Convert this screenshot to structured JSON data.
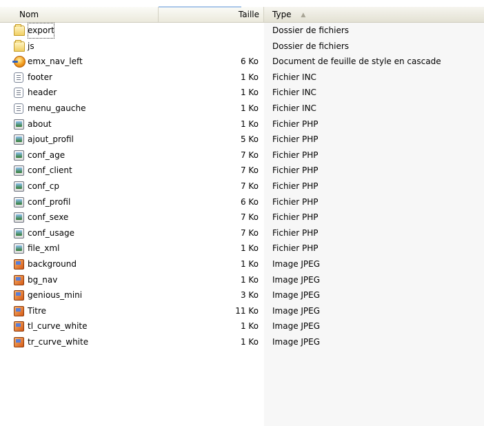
{
  "columns": {
    "name": "Nom",
    "size": "Taille",
    "type": "Type"
  },
  "sort_column": "type",
  "files": [
    {
      "name": "export",
      "size": "",
      "type": "Dossier de fichiers",
      "icon": "folder-icon",
      "focused": true
    },
    {
      "name": "js",
      "size": "",
      "type": "Dossier de fichiers",
      "icon": "folder-icon"
    },
    {
      "name": "emx_nav_left",
      "size": "6 Ko",
      "type": "Document de feuille de style en cascade",
      "icon": "css-file-icon"
    },
    {
      "name": "footer",
      "size": "1 Ko",
      "type": "Fichier INC",
      "icon": "text-file-icon"
    },
    {
      "name": "header",
      "size": "1 Ko",
      "type": "Fichier INC",
      "icon": "text-file-icon"
    },
    {
      "name": "menu_gauche",
      "size": "1 Ko",
      "type": "Fichier INC",
      "icon": "text-file-icon"
    },
    {
      "name": "about",
      "size": "1 Ko",
      "type": "Fichier PHP",
      "icon": "php-file-icon"
    },
    {
      "name": "ajout_profil",
      "size": "5 Ko",
      "type": "Fichier PHP",
      "icon": "php-file-icon"
    },
    {
      "name": "conf_age",
      "size": "7 Ko",
      "type": "Fichier PHP",
      "icon": "php-file-icon"
    },
    {
      "name": "conf_client",
      "size": "7 Ko",
      "type": "Fichier PHP",
      "icon": "php-file-icon"
    },
    {
      "name": "conf_cp",
      "size": "7 Ko",
      "type": "Fichier PHP",
      "icon": "php-file-icon"
    },
    {
      "name": "conf_profil",
      "size": "6 Ko",
      "type": "Fichier PHP",
      "icon": "php-file-icon"
    },
    {
      "name": "conf_sexe",
      "size": "7 Ko",
      "type": "Fichier PHP",
      "icon": "php-file-icon"
    },
    {
      "name": "conf_usage",
      "size": "7 Ko",
      "type": "Fichier PHP",
      "icon": "php-file-icon"
    },
    {
      "name": "file_xml",
      "size": "1 Ko",
      "type": "Fichier PHP",
      "icon": "php-file-icon"
    },
    {
      "name": "background",
      "size": "1 Ko",
      "type": "Image JPEG",
      "icon": "jpeg-file-icon"
    },
    {
      "name": "bg_nav",
      "size": "1 Ko",
      "type": "Image JPEG",
      "icon": "jpeg-file-icon"
    },
    {
      "name": "genious_mini",
      "size": "3 Ko",
      "type": "Image JPEG",
      "icon": "jpeg-file-icon"
    },
    {
      "name": "Titre",
      "size": "11 Ko",
      "type": "Image JPEG",
      "icon": "jpeg-file-icon"
    },
    {
      "name": "tl_curve_white",
      "size": "1 Ko",
      "type": "Image JPEG",
      "icon": "jpeg-file-icon"
    },
    {
      "name": "tr_curve_white",
      "size": "1 Ko",
      "type": "Image JPEG",
      "icon": "jpeg-file-icon"
    }
  ],
  "colors": {
    "header_bg": "#ebe9dc",
    "sorted_column_bg": "#f7f7f7",
    "sort_indicator": "#a9c6e9"
  }
}
